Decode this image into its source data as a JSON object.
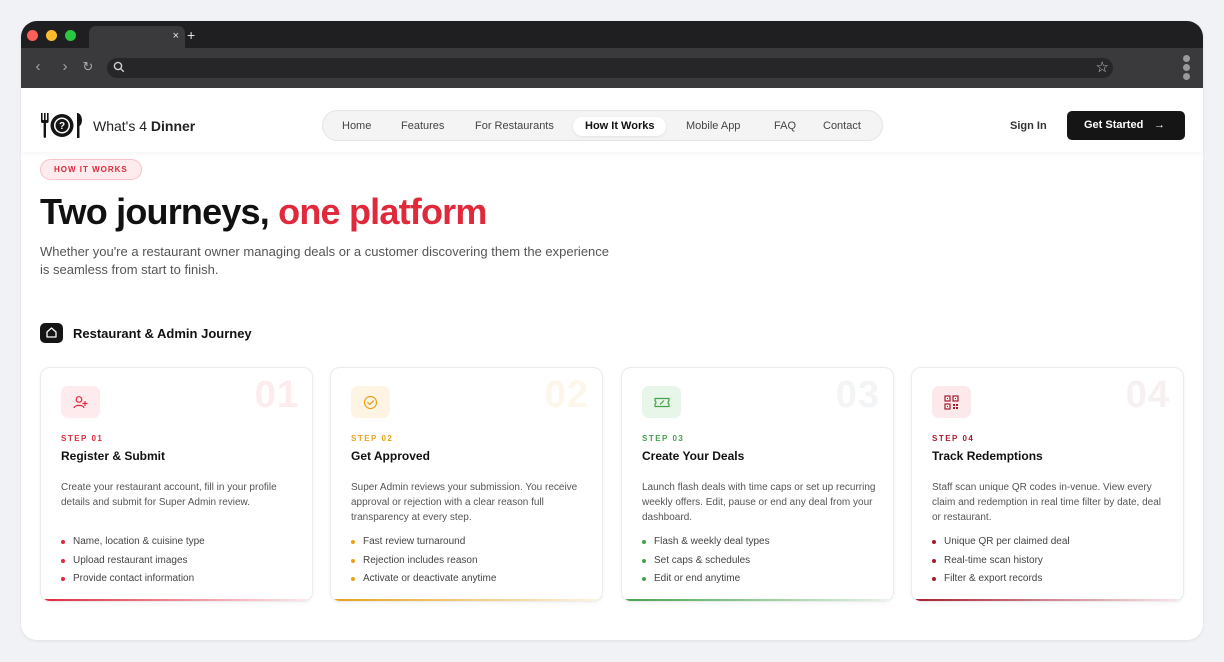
{
  "browser": {
    "tab_close": "×",
    "tab_new": "+",
    "back": "‹",
    "forward": "›",
    "reload": "↻",
    "bookmark": "☆"
  },
  "header": {
    "logo_icon": "dinner-plate-icon",
    "brand_regular": "What's 4 ",
    "brand_bold": "Dinner",
    "nav": [
      "Home",
      "Features",
      "For Restaurants",
      "How It Works",
      "Mobile App",
      "FAQ",
      "Contact"
    ],
    "active_nav": "How It Works",
    "sign_in": "Sign In",
    "cta": "Get Started",
    "cta_arrow": "→"
  },
  "hero": {
    "eyebrow": "HOW IT WORKS",
    "title_main": "Two journeys, ",
    "title_accent": "one platform",
    "subtitle": "Whether you're a restaurant owner managing deals or a customer discovering them the experience is seamless from start to finish."
  },
  "journey": {
    "icon": "home-icon",
    "title": "Restaurant & Admin Journey"
  },
  "cards": [
    {
      "number": "01",
      "step": "STEP 01",
      "title": "Register & Submit",
      "description": "Create your restaurant account, fill in your profile details and submit for Super Admin review.",
      "bullets": [
        "Name, location & cuisine type",
        "Upload restaurant images",
        "Provide contact information"
      ],
      "icon": "user-plus-icon",
      "accent": "#e0293b",
      "tint": "#fdebed",
      "num_color": "#fcecee"
    },
    {
      "number": "02",
      "step": "STEP 02",
      "title": "Get Approved",
      "description": "Super Admin reviews your submission. You receive approval or rejection with a clear reason full transparency at every step.",
      "bullets": [
        "Fast review turnaround",
        "Rejection includes reason",
        "Activate or deactivate anytime"
      ],
      "icon": "check-circle-icon",
      "accent": "#e8a21a",
      "tint": "#fdf4e3",
      "num_color": "#fdf6ea"
    },
    {
      "number": "03",
      "step": "STEP 03",
      "title": "Create Your Deals",
      "description": "Launch flash deals with time caps or set up recurring weekly offers. Edit, pause or end any deal from your dashboard.",
      "bullets": [
        "Flash & weekly deal types",
        "Set caps & schedules",
        "Edit or end anytime"
      ],
      "icon": "ticket-icon",
      "accent": "#43a34a",
      "tint": "#e8f5e9",
      "num_color": "#f3f4f5"
    },
    {
      "number": "04",
      "step": "STEP 04",
      "title": "Track Redemptions",
      "description": "Staff scan unique QR codes in-venue. View every claim and redemption in real time filter by date, deal or restaurant.",
      "bullets": [
        "Unique QR per claimed deal",
        "Real-time scan history",
        "Filter & export records"
      ],
      "icon": "qr-code-icon",
      "accent": "#a61d2d",
      "tint": "#fbe9eb",
      "num_color": "#f7f0f1"
    }
  ]
}
